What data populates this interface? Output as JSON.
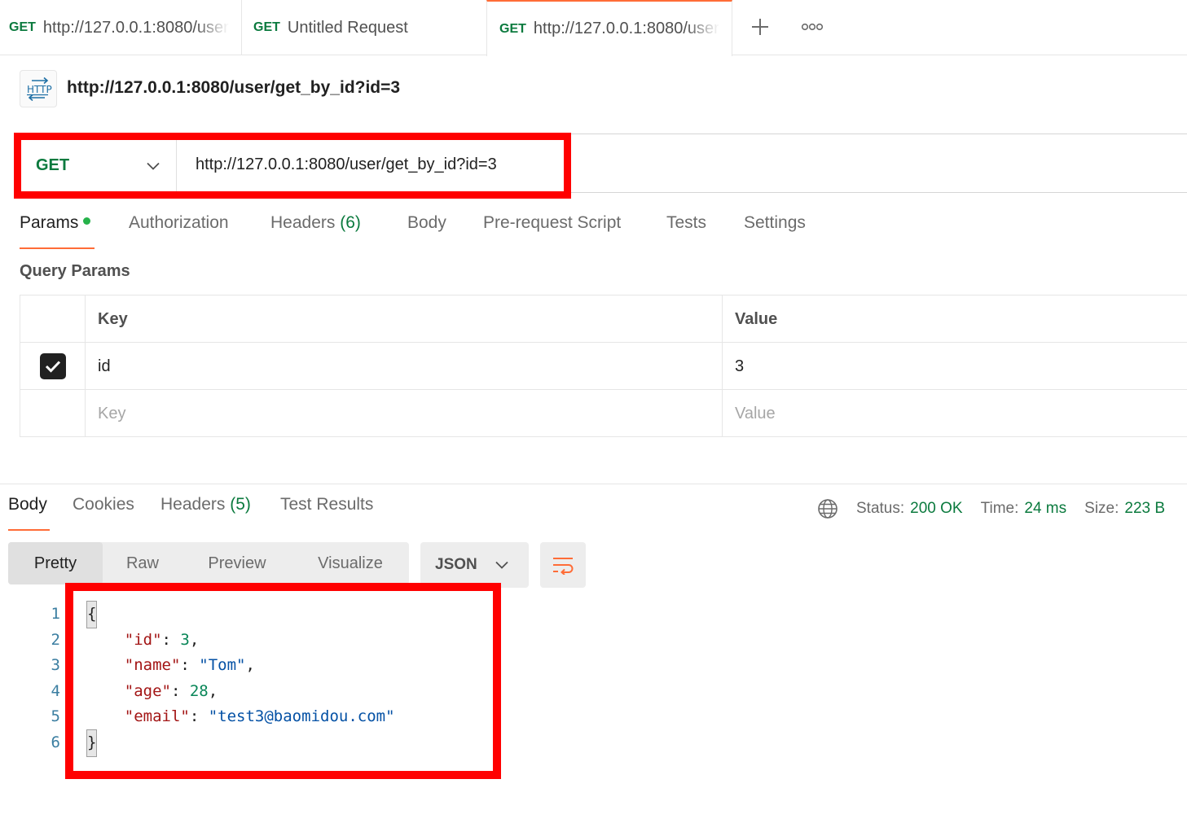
{
  "tabs": [
    {
      "method": "GET",
      "title": "http://127.0.0.1:8080/user"
    },
    {
      "method": "GET",
      "title": "Untitled Request"
    },
    {
      "method": "GET",
      "title": "http://127.0.0.1:8080/user"
    }
  ],
  "header": {
    "icon_text": "HTTP",
    "title": "http://127.0.0.1:8080/user/get_by_id?id=3"
  },
  "request": {
    "method": "GET",
    "url": "http://127.0.0.1:8080/user/get_by_id?id=3"
  },
  "request_tabs": {
    "params": "Params",
    "authorization": "Authorization",
    "headers": "Headers",
    "headers_count": "(6)",
    "body": "Body",
    "prerequest": "Pre-request Script",
    "tests": "Tests",
    "settings": "Settings"
  },
  "query_params": {
    "title": "Query Params",
    "columns": {
      "key": "Key",
      "value": "Value"
    },
    "rows": [
      {
        "checked": true,
        "key": "id",
        "value": "3"
      }
    ],
    "new_row": {
      "key_placeholder": "Key",
      "value_placeholder": "Value"
    }
  },
  "response_tabs": {
    "body": "Body",
    "cookies": "Cookies",
    "headers": "Headers",
    "headers_count": "(5)",
    "test_results": "Test Results"
  },
  "response_status": {
    "status_label": "Status:",
    "status_value": "200 OK",
    "time_label": "Time:",
    "time_value": "24 ms",
    "size_label": "Size:",
    "size_value": "223 B"
  },
  "view_modes": {
    "pretty": "Pretty",
    "raw": "Raw",
    "preview": "Preview",
    "visualize": "Visualize",
    "format": "JSON"
  },
  "response_body": {
    "line_numbers": [
      "1",
      "2",
      "3",
      "4",
      "5",
      "6"
    ],
    "open_brace": "{",
    "close_brace": "}",
    "fields": [
      {
        "key": "\"id\"",
        "value": "3",
        "value_type": "number",
        "trail": ","
      },
      {
        "key": "\"name\"",
        "value": "\"Tom\"",
        "value_type": "string",
        "trail": ","
      },
      {
        "key": "\"age\"",
        "value": "28",
        "value_type": "number",
        "trail": ","
      },
      {
        "key": "\"email\"",
        "value": "\"test3@baomidou.com\"",
        "value_type": "string",
        "trail": ""
      }
    ]
  },
  "colors": {
    "method_green": "#0b7a3e",
    "accent_orange": "#ff6c37",
    "highlight_red": "#ff0000"
  }
}
